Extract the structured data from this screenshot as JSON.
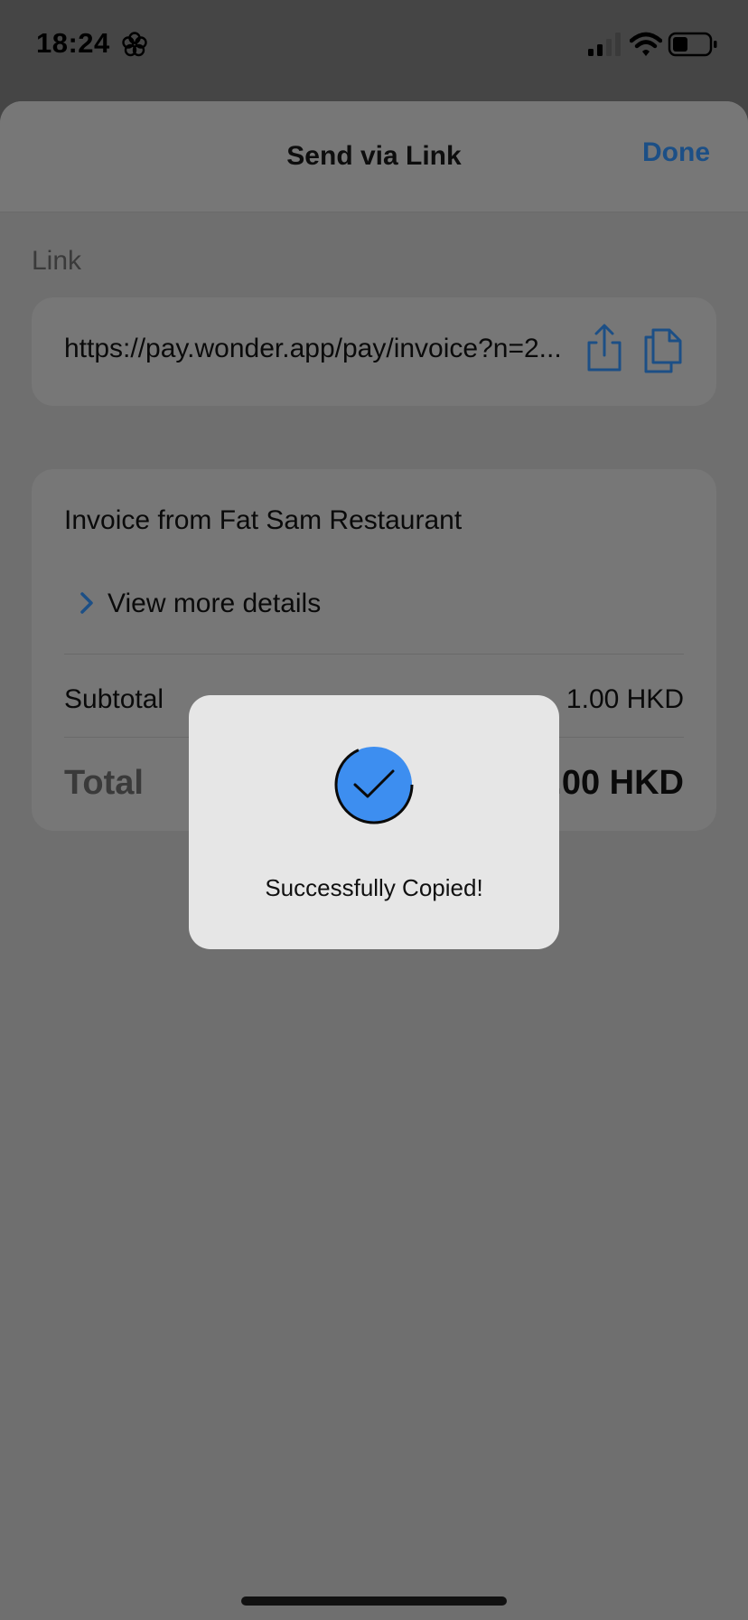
{
  "status_bar": {
    "time": "18:24",
    "icons": [
      "flower-icon",
      "cellular-signal-icon",
      "wifi-icon",
      "battery-icon"
    ]
  },
  "nav": {
    "title": "Send via Link",
    "done_label": "Done"
  },
  "link_section": {
    "label": "Link",
    "url": "https://pay.wonder.app/pay/invoice?n=2...",
    "actions": [
      "share-icon",
      "copy-icon"
    ]
  },
  "invoice": {
    "title": "Invoice from Fat Sam Restaurant",
    "details_label": "View more details",
    "subtotal_label": "Subtotal",
    "subtotal_value": "1.00 HKD",
    "total_label": "Total",
    "total_value": "1.00 HKD"
  },
  "toast": {
    "message": "Successfully Copied!",
    "icon": "checkmark-circle-icon"
  },
  "colors": {
    "accent": "#1c4f86",
    "toast_check": "#3d8ef0",
    "overlay_bg": "#6f6f6f",
    "toast_bg": "#e6e6e6"
  }
}
